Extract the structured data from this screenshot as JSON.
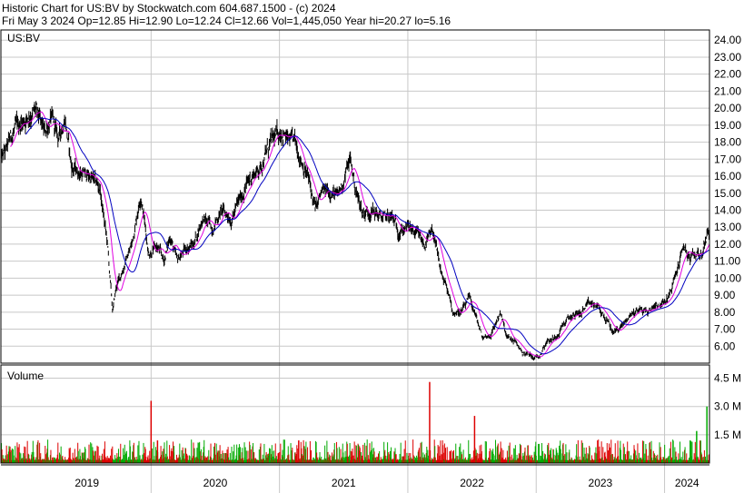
{
  "header": {
    "title": "Historic Chart for US:BV by Stockwatch.com 604.687.1500 - (c) 2024",
    "quote": "Fri May  3 2024  Op=12.85  Hi=12.90  Lo=12.24  Cl=12.66  Vol=1,445,050  Year hi=20.27  lo=5.16"
  },
  "chart_data": {
    "type": "line",
    "symbol_label": "US:BV",
    "volume_label": "Volume",
    "x_labels": [
      "2019",
      "2020",
      "2021",
      "2022",
      "2023",
      "2024"
    ],
    "price_ticks": [
      "24.00",
      "23.00",
      "22.00",
      "21.00",
      "20.00",
      "19.00",
      "18.00",
      "17.00",
      "16.00",
      "15.00",
      "14.00",
      "13.00",
      "12.00",
      "11.00",
      "10.00",
      "9.00",
      "8.00",
      "7.00",
      "6.00"
    ],
    "volume_ticks": [
      "4.5 M",
      "3.0 M",
      "1.5 M"
    ],
    "price_ylim": [
      5.0,
      24.6
    ],
    "volume_ylim": [
      0,
      5.2
    ],
    "x_range": [
      2018.83,
      2024.35
    ],
    "price_anchors": [
      [
        2018.83,
        16.9
      ],
      [
        2018.87,
        17.5
      ],
      [
        2018.92,
        18.5
      ],
      [
        2018.97,
        19.0
      ],
      [
        2019.05,
        19.6
      ],
      [
        2019.1,
        19.8
      ],
      [
        2019.17,
        18.5
      ],
      [
        2019.22,
        19.4
      ],
      [
        2019.28,
        18.2
      ],
      [
        2019.33,
        19.5
      ],
      [
        2019.38,
        16.5
      ],
      [
        2019.45,
        16.2
      ],
      [
        2019.52,
        16.0
      ],
      [
        2019.6,
        15.3
      ],
      [
        2019.66,
        12.0
      ],
      [
        2019.7,
        8.0
      ],
      [
        2019.73,
        9.5
      ],
      [
        2019.78,
        10.5
      ],
      [
        2019.85,
        12.0
      ],
      [
        2019.92,
        15.0
      ],
      [
        2019.98,
        11.5
      ],
      [
        2020.05,
        11.8
      ],
      [
        2020.1,
        11.0
      ],
      [
        2020.15,
        12.5
      ],
      [
        2020.2,
        11.0
      ],
      [
        2020.28,
        11.8
      ],
      [
        2020.33,
        12.0
      ],
      [
        2020.4,
        13.5
      ],
      [
        2020.48,
        13.0
      ],
      [
        2020.55,
        14.0
      ],
      [
        2020.63,
        13.5
      ],
      [
        2020.7,
        14.8
      ],
      [
        2020.78,
        16.0
      ],
      [
        2020.85,
        16.5
      ],
      [
        2020.92,
        17.8
      ],
      [
        2020.97,
        18.3
      ],
      [
        2021.02,
        18.7
      ],
      [
        2021.07,
        18.0
      ],
      [
        2021.12,
        18.0
      ],
      [
        2021.17,
        17.0
      ],
      [
        2021.22,
        16.0
      ],
      [
        2021.28,
        14.0
      ],
      [
        2021.33,
        15.0
      ],
      [
        2021.4,
        15.2
      ],
      [
        2021.45,
        14.7
      ],
      [
        2021.5,
        15.8
      ],
      [
        2021.55,
        17.0
      ],
      [
        2021.6,
        15.0
      ],
      [
        2021.65,
        13.8
      ],
      [
        2021.72,
        14.0
      ],
      [
        2021.8,
        13.5
      ],
      [
        2021.87,
        13.6
      ],
      [
        2021.93,
        12.8
      ],
      [
        2022.0,
        13.0
      ],
      [
        2022.07,
        12.5
      ],
      [
        2022.13,
        12.0
      ],
      [
        2022.2,
        12.7
      ],
      [
        2022.25,
        10.5
      ],
      [
        2022.3,
        9.5
      ],
      [
        2022.35,
        8.0
      ],
      [
        2022.42,
        8.0
      ],
      [
        2022.48,
        8.8
      ],
      [
        2022.52,
        8.0
      ],
      [
        2022.58,
        6.5
      ],
      [
        2022.65,
        6.7
      ],
      [
        2022.72,
        8.0
      ],
      [
        2022.77,
        6.5
      ],
      [
        2022.83,
        6.3
      ],
      [
        2022.9,
        5.6
      ],
      [
        2022.98,
        5.4
      ],
      [
        2023.02,
        5.4
      ],
      [
        2023.08,
        6.3
      ],
      [
        2023.15,
        6.5
      ],
      [
        2023.2,
        7.2
      ],
      [
        2023.28,
        7.8
      ],
      [
        2023.35,
        8.0
      ],
      [
        2023.42,
        8.5
      ],
      [
        2023.48,
        8.3
      ],
      [
        2023.55,
        7.5
      ],
      [
        2023.6,
        6.8
      ],
      [
        2023.67,
        7.2
      ],
      [
        2023.73,
        7.8
      ],
      [
        2023.8,
        8.2
      ],
      [
        2023.87,
        8.0
      ],
      [
        2023.93,
        8.5
      ],
      [
        2024.0,
        8.5
      ],
      [
        2024.05,
        9.2
      ],
      [
        2024.1,
        10.5
      ],
      [
        2024.15,
        12.0
      ],
      [
        2024.2,
        11.0
      ],
      [
        2024.25,
        11.5
      ],
      [
        2024.3,
        11.5
      ],
      [
        2024.33,
        12.66
      ]
    ],
    "volume_spikes": [
      [
        2020.0,
        3.3
      ],
      [
        2022.17,
        4.3
      ],
      [
        2022.52,
        2.5
      ],
      [
        2024.33,
        3.0
      ],
      [
        2024.25,
        1.7
      ],
      [
        2024.2,
        1.2
      ],
      [
        2020.05,
        1.2
      ],
      [
        2021.15,
        1.2
      ]
    ],
    "colors": {
      "price": "#000000",
      "ma_short": "#e000e0",
      "ma_long": "#0000c0",
      "volume_up": "#00aa00",
      "volume_down": "#dd0000",
      "grid": "#c8c8c8",
      "frame": "#000000"
    }
  }
}
